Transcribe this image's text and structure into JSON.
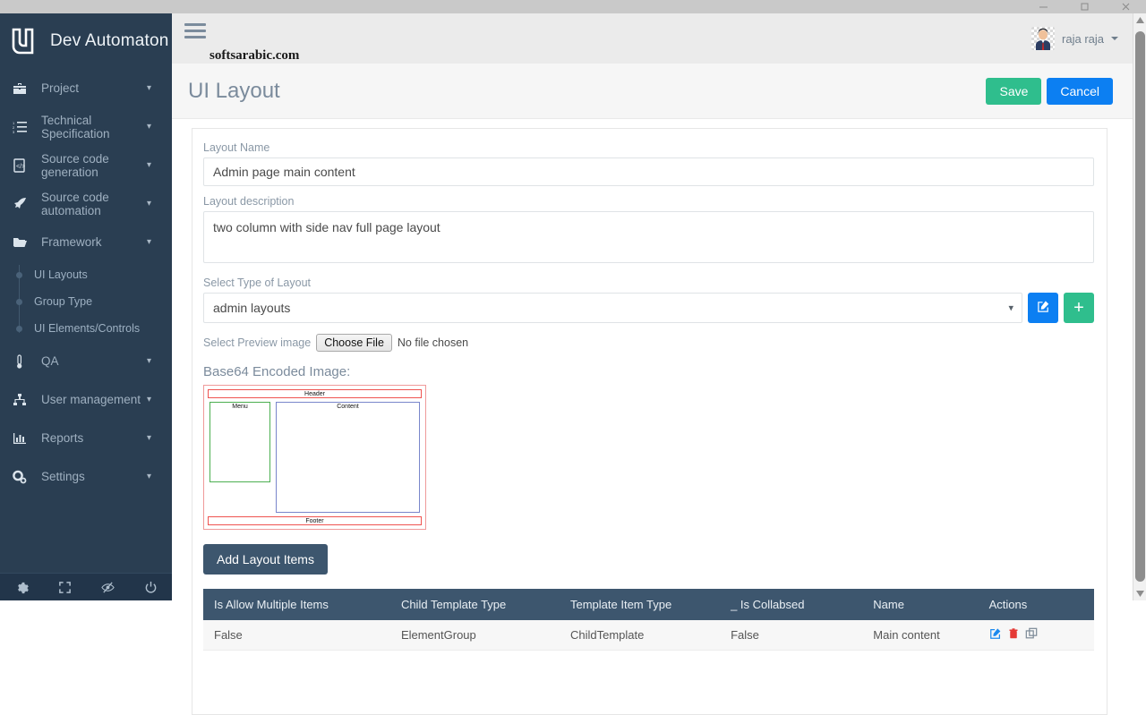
{
  "window": {
    "minimize_label": "Minimize",
    "maximize_label": "Maximize",
    "close_label": "Close"
  },
  "sidebar": {
    "brand": "Dev Automaton",
    "items": [
      {
        "label": "Project",
        "icon": "briefcase-icon",
        "has_chevron": true
      },
      {
        "label": "Technical Specification",
        "icon": "ordered-list-icon",
        "has_chevron": true
      },
      {
        "label": "Source code generation",
        "icon": "code-file-icon",
        "has_chevron": true
      },
      {
        "label": "Source code automation",
        "icon": "rocket-icon",
        "has_chevron": true
      },
      {
        "label": "Framework",
        "icon": "folder-open-icon",
        "has_chevron": true
      }
    ],
    "framework_subitems": [
      {
        "label": "UI Layouts"
      },
      {
        "label": "Group Type"
      },
      {
        "label": "UI Elements/Controls"
      }
    ],
    "items_after": [
      {
        "label": "QA",
        "icon": "thermometer-icon",
        "has_chevron": true
      },
      {
        "label": "User management",
        "icon": "sitemap-icon",
        "has_chevron": true
      },
      {
        "label": "Reports",
        "icon": "bar-chart-icon",
        "has_chevron": true
      },
      {
        "label": "Settings",
        "icon": "gears-icon",
        "has_chevron": true
      }
    ],
    "footer_icons": [
      {
        "name": "gear-icon"
      },
      {
        "name": "expand-icon"
      },
      {
        "name": "eye-slash-icon"
      },
      {
        "name": "power-off-icon"
      }
    ]
  },
  "topbar": {
    "menu_toggle": "hamburger-icon",
    "watermark": "softsarabic.com",
    "username": "raja raja"
  },
  "page": {
    "title": "UI Layout",
    "save_label": "Save",
    "cancel_label": "Cancel"
  },
  "form": {
    "layout_name_label": "Layout Name",
    "layout_name_value": "Admin page main content",
    "layout_name_placeholder": "Layout Name",
    "description_label": "Layout description",
    "description_value": "two column with side nav full page layout",
    "description_placeholder": "Layout description",
    "type_label": "Select Type of Layout",
    "type_value": "admin layouts",
    "type_options": [
      "admin layouts"
    ],
    "preview_image_label": "Select Preview image",
    "choose_file_label": "Choose File",
    "no_file_label": "No file chosen",
    "base64_label": "Base64 Encoded Image:",
    "edit_type_icon": "edit-square-icon",
    "add_type_icon": "plus-icon"
  },
  "preview_diagram": {
    "header": "Header",
    "menu": "Menu",
    "content": "Content",
    "footer": "Footer",
    "colors": {
      "outer": "#ef9a9a",
      "header_footer": "#ef5350",
      "menu": "#4caf50",
      "content": "#7986cb"
    }
  },
  "layout_items": {
    "add_button_label": "Add Layout Items",
    "columns": [
      "Is Allow Multiple Items",
      "Child Template Type",
      "Template Item Type",
      "_ Is Collabsed",
      "Name",
      "Actions"
    ],
    "rows": [
      {
        "is_allow_multiple_items": "False",
        "child_template_type": "ElementGroup",
        "template_item_type": "ChildTemplate",
        "is_collabsed": "False",
        "name": "Main content",
        "actions": [
          "edit-icon",
          "delete-icon",
          "copy-icon"
        ]
      }
    ]
  },
  "theme": {
    "sidebar_bg": "#2a3e52",
    "table_header_bg": "#3d566e",
    "save_green": "#2fbe8d",
    "cancel_blue": "#0c7ff2",
    "title_gray": "#7b8b9c"
  }
}
